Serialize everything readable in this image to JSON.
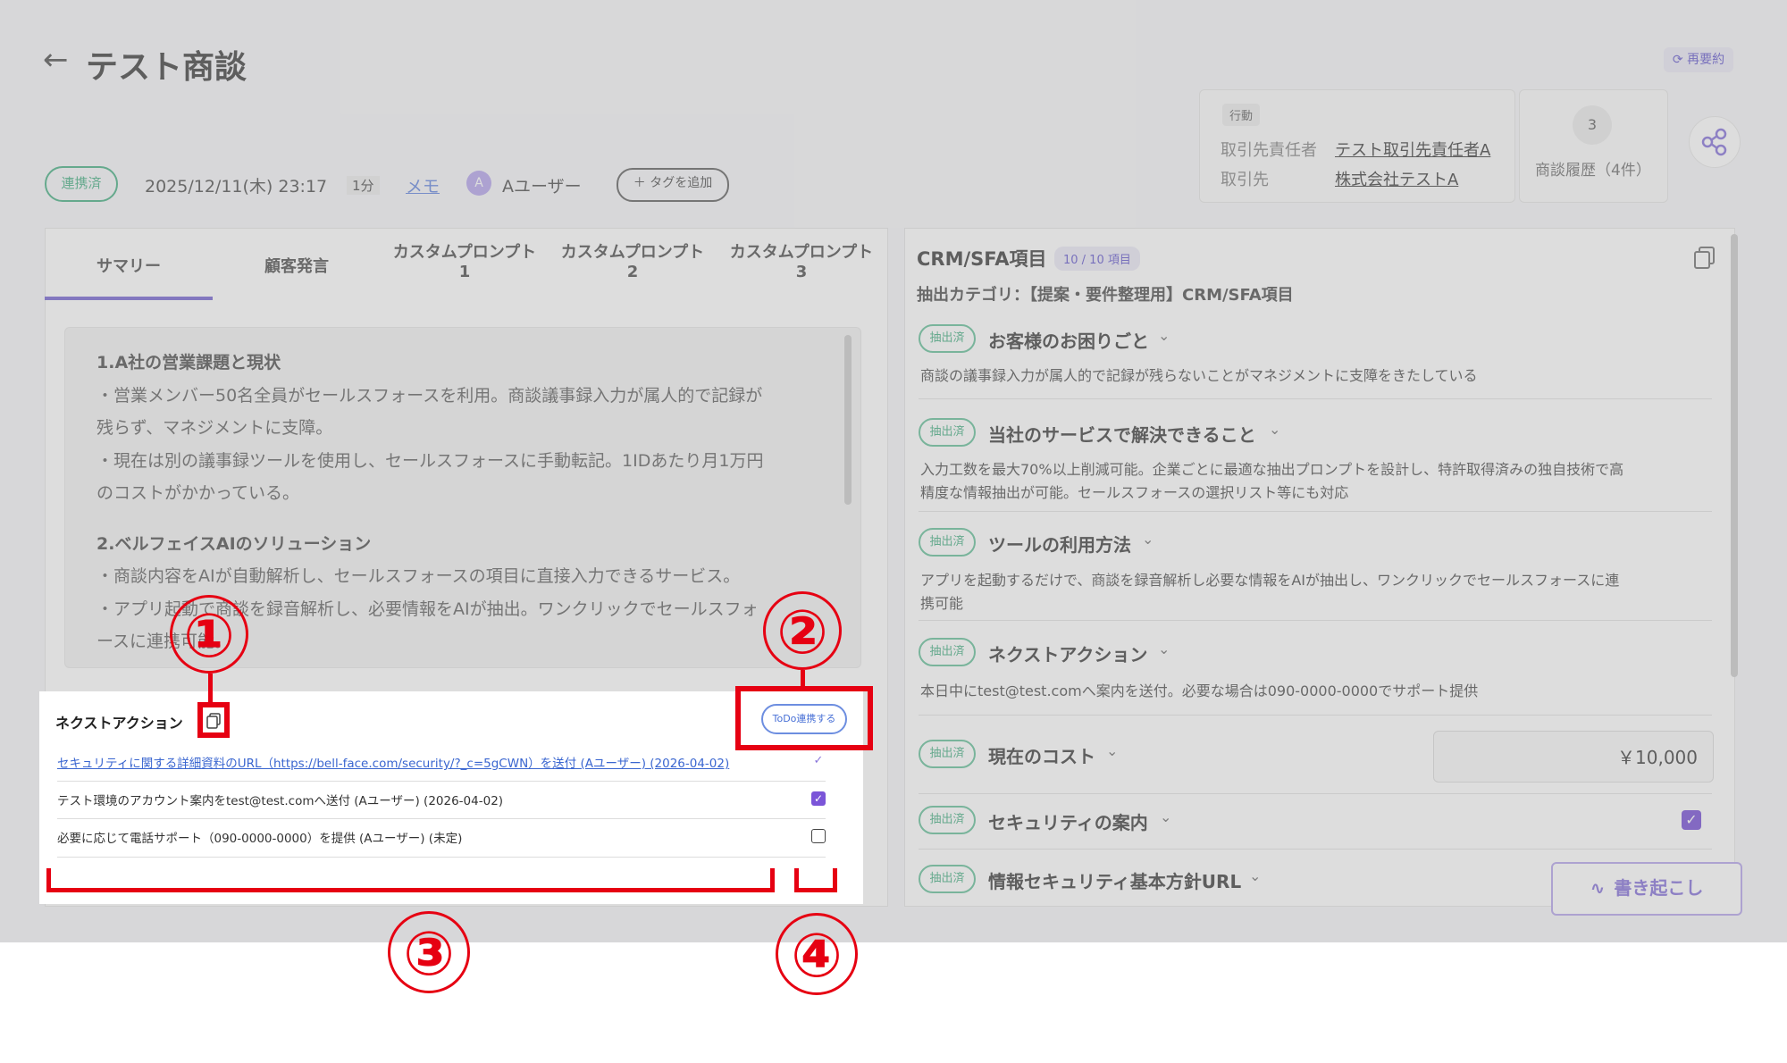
{
  "header": {
    "title": "テスト商談",
    "resummary_label": "再要約",
    "action_badge": "行動",
    "contact_label": "取引先責任者",
    "contact_value": "テスト取引先責任者A",
    "account_label": "取引先",
    "account_value": "株式会社テストA",
    "history_count": "3",
    "history_label": "商談履歴（4件）"
  },
  "meta": {
    "status": "連携済",
    "datetime": "2025/12/11(木) 23:17",
    "duration": "1分",
    "memo": "メモ",
    "avatar_initial": "A",
    "user": "Aユーザー",
    "add_tag": "＋ タグを追加"
  },
  "tabs": [
    {
      "l1": "サマリー",
      "l2": ""
    },
    {
      "l1": "顧客発言",
      "l2": ""
    },
    {
      "l1": "カスタムプロンプト",
      "l2": "1"
    },
    {
      "l1": "カスタムプロンプト",
      "l2": "2"
    },
    {
      "l1": "カスタムプロンプト",
      "l2": "3"
    }
  ],
  "summary": {
    "s1_title": "1.A社の営業課題と現状",
    "s1_l1": "・営業メンバー50名全員がセールスフォースを利用。商談議事録入力が属人的で記録が",
    "s1_l2": "残らず、マネジメントに支障。",
    "s1_l3": "・現在は別の議事録ツールを使用し、セールスフォースに手動転記。1IDあたり月1万円",
    "s1_l4": "のコストがかかっている。",
    "s2_title": "2.ベルフェイスAIのソリューション",
    "s2_l1": "・商談内容をAIが自動解析し、セールスフォースの項目に直接入力できるサービス。",
    "s2_l2": "・アプリ起動で商談を録音解析し、必要情報をAIが抽出。ワンクリックでセールスフォ",
    "s2_l3": "ースに連携可能。"
  },
  "crm": {
    "title": "CRM/SFA項目",
    "count": "10 / 10 項目",
    "category": "抽出カテゴリ：【提案・要件整理用】CRM/SFA項目",
    "chip": "抽出済",
    "f1_title": "お客様のお困りごと",
    "f1_desc": "商談の議事録入力が属人的で記録が残らないことがマネジメントに支障をきたしている",
    "f2_title": "当社のサービスで解決できること",
    "f2_desc1": "入力工数を最大70%以上削減可能。企業ごとに最適な抽出プロンプトを設計し、特許取得済みの独自技術で高",
    "f2_desc2": "精度な情報抽出が可能。セールスフォースの選択リスト等にも対応",
    "f3_title": "ツールの利用方法",
    "f3_desc1": "アプリを起動するだけで、商談を録音解析し必要な情報をAIが抽出し、ワンクリックでセールスフォースに連",
    "f3_desc2": "携可能",
    "f4_title": "ネクストアクション",
    "f4_desc": "本日中にtest@test.comへ案内を送付。必要な場合は090-0000-0000でサポート提供",
    "f5_title": "現在のコスト",
    "f5_value": "￥10,000",
    "f6_title": "セキュリティの案内",
    "f7_title": "情報セキュリティ基本方針URL",
    "transcribe": "書き起こし"
  },
  "next_action": {
    "title": "ネクストアクション",
    "todo_button": "ToDo連携する",
    "items": [
      "セキュリティに関する詳細資料のURL（https://bell-face.com/security/?_c=5gCWN）を送付 (Aユーザー) (2026-04-02)",
      "テスト環境のアカウント案内をtest@test.comへ送付 (Aユーザー) (2026-04-02)",
      "必要に応じて電話サポート（090-0000-0000）を提供 (Aユーザー) (未定)"
    ]
  },
  "annotations": [
    "①",
    "②",
    "③",
    "④"
  ],
  "colors": {
    "accent": "#7b55d8",
    "annotation": "#e60012",
    "success": "#4fb389",
    "link": "#3a66d0"
  }
}
